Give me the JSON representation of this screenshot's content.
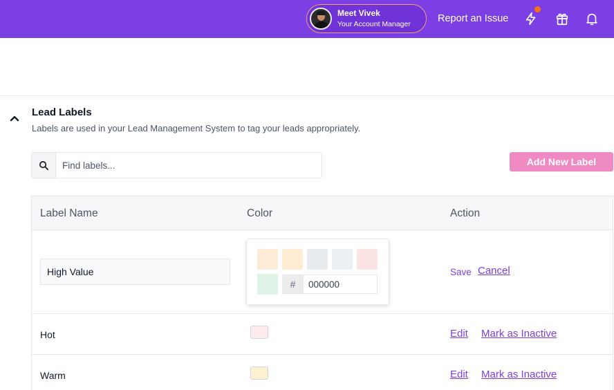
{
  "header": {
    "account_manager": {
      "name": "Meet Vivek",
      "role": "Your Account Manager"
    },
    "report_issue": "Report an Issue",
    "icons": [
      "bolt-icon",
      "gift-icon",
      "bell-icon"
    ],
    "accent": "#7b3fe4",
    "notification_dot_color": "#f97316"
  },
  "section": {
    "title": "Lead Labels",
    "description": "Labels are used in your Lead Management System to tag your leads appropriately."
  },
  "search": {
    "placeholder": "Find labels...",
    "value": ""
  },
  "add_button": {
    "label": "Add New Label",
    "color": "#f08ac3"
  },
  "table": {
    "headers": {
      "name": "Label Name",
      "color": "Color",
      "action": "Action"
    },
    "editing_row": {
      "name_value": "High Value",
      "swatches": [
        "#fdebd8",
        "#fdebd3",
        "#e8ebee",
        "#ecf0f2",
        "#fde4e4",
        "#dff3e6"
      ],
      "hash": "#",
      "hex_value": "000000",
      "save_label": "Save",
      "cancel_label": "Cancel"
    },
    "rows": [
      {
        "name": "Hot",
        "color": "#fdecec",
        "edit_label": "Edit",
        "inactive_label": "Mark as Inactive"
      },
      {
        "name": "Warm",
        "color": "#fdf1d2",
        "edit_label": "Edit",
        "inactive_label": "Mark as Inactive"
      }
    ]
  }
}
